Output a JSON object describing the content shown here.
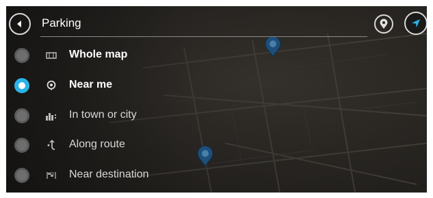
{
  "header": {
    "search_value": "Parking"
  },
  "options": [
    {
      "label": "Whole map",
      "selected": false,
      "bold": true,
      "icon": "map-icon"
    },
    {
      "label": "Near me",
      "selected": true,
      "bold": true,
      "icon": "location-pin-icon"
    },
    {
      "label": "In town or city",
      "selected": false,
      "bold": false,
      "icon": "city-icon"
    },
    {
      "label": "Along route",
      "selected": false,
      "bold": false,
      "icon": "route-icon"
    },
    {
      "label": "Near destination",
      "selected": false,
      "bold": false,
      "icon": "destination-flag-icon"
    }
  ],
  "colors": {
    "accent": "#2ab3e6",
    "background": "#2a2723",
    "text": "#ffffff"
  }
}
